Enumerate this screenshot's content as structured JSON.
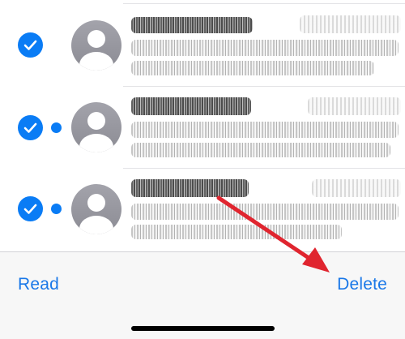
{
  "colors": {
    "accent": "#0a7cf5",
    "toolbar_text": "#1a78e8",
    "annotation_arrow": "#e0252f",
    "avatar": "#98989f"
  },
  "messages": [
    {
      "selected": true,
      "unread": false,
      "avatar_icon": "person-icon"
    },
    {
      "selected": true,
      "unread": true,
      "avatar_icon": "person-icon"
    },
    {
      "selected": true,
      "unread": true,
      "avatar_icon": "person-icon"
    }
  ],
  "toolbar": {
    "read_label": "Read",
    "delete_label": "Delete"
  }
}
